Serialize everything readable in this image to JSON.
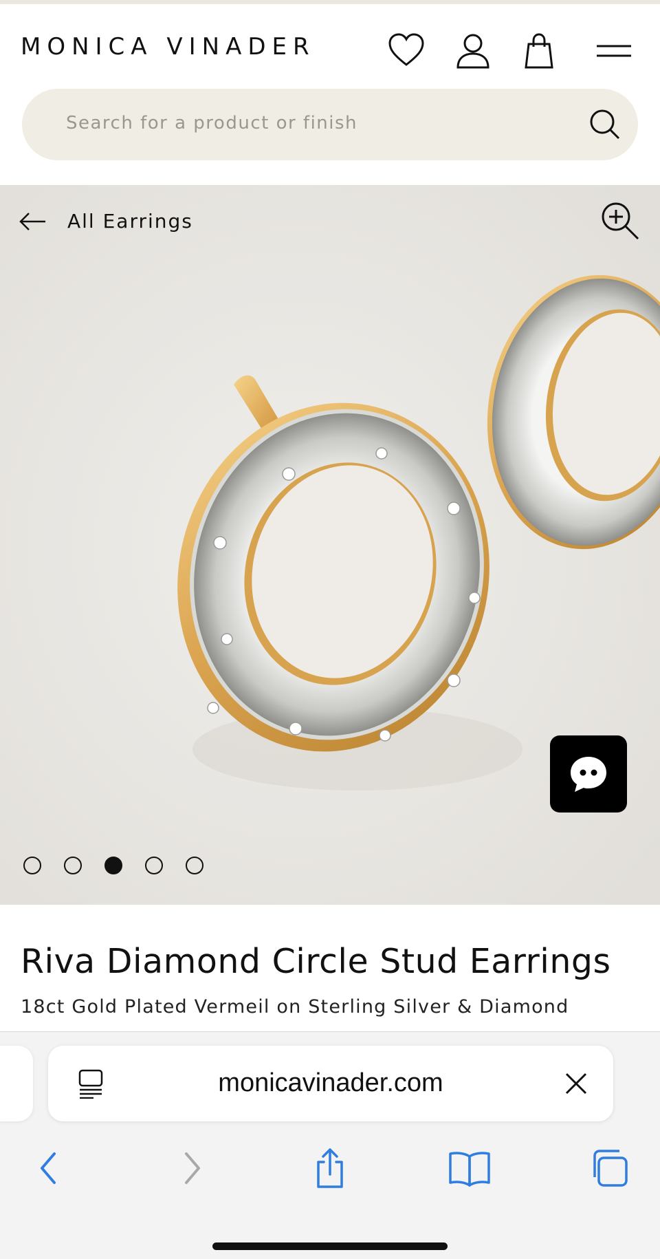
{
  "header": {
    "logo": "MONICA VINADER",
    "search_placeholder": "Search for a product or finish"
  },
  "gallery": {
    "back_label": "All Earrings",
    "slide_count": 5,
    "active_slide_index": 2
  },
  "product": {
    "title": "Riva Diamond Circle Stud Earrings",
    "subtitle": "18ct Gold Plated Vermeil on Sterling Silver & Diamond"
  },
  "browser": {
    "url": "monicavinader.com"
  },
  "colors": {
    "search_bg": "#f0ede4",
    "gallery_bg": "#e8e6e2",
    "safari_blue": "#2f7de1",
    "disabled_gray": "#a8a8a8"
  },
  "icons": {
    "wishlist": "heart-icon",
    "account": "user-icon",
    "bag": "shopping-bag-icon",
    "menu": "hamburger-menu-icon",
    "search": "search-icon",
    "back": "arrow-left-icon",
    "zoom": "zoom-in-icon",
    "chat": "chat-icon",
    "reader": "reader-mode-icon",
    "close": "close-icon",
    "nav_back": "chevron-left-icon",
    "nav_forward": "chevron-right-icon",
    "share": "share-icon",
    "bookmarks": "book-icon",
    "tabs": "tabs-icon"
  }
}
